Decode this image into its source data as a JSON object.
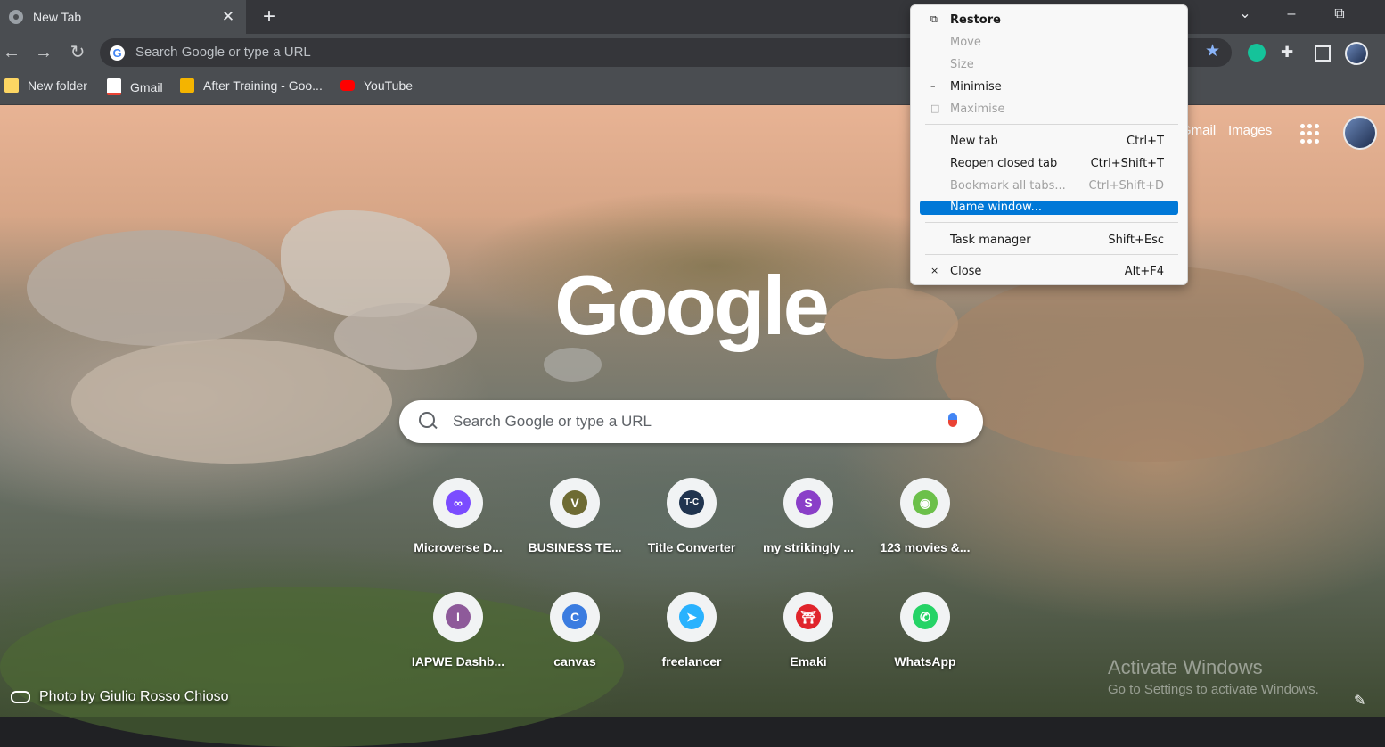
{
  "tab": {
    "title": "New Tab"
  },
  "window_controls": {
    "dropdown": "⌄",
    "minimize": "–",
    "restore": "⧉"
  },
  "omnibox": {
    "placeholder": "Search Google or type a URL"
  },
  "bookmarks": [
    {
      "label": "New folder",
      "icon": "folder-icon",
      "color": "#fdd663"
    },
    {
      "label": "Gmail",
      "icon": "gmail-icon",
      "color": "#ea4335"
    },
    {
      "label": "After Training - Goo...",
      "icon": "slides-icon",
      "color": "#f4b400"
    },
    {
      "label": "YouTube",
      "icon": "youtube-icon",
      "color": "#ff0000"
    }
  ],
  "ntp": {
    "top_links": {
      "gmail": "Gmail",
      "images": "Images"
    },
    "logo": "Google",
    "search_placeholder": "Search Google or type a URL",
    "shortcuts": [
      {
        "label": "Microverse D...",
        "icon_text": "∞",
        "color": "#7b4cff"
      },
      {
        "label": "BUSINESS TE...",
        "icon_text": "V",
        "color": "#6e6b33"
      },
      {
        "label": "Title Converter",
        "icon_text": "T-C",
        "color": "#20344f"
      },
      {
        "label": "my strikingly ...",
        "icon_text": "S",
        "color": "#8a3fc8"
      },
      {
        "label": "123 movies &...",
        "icon_text": "◉",
        "color": "#6cc04a"
      },
      {
        "label": "IAPWE Dashb...",
        "icon_text": "I",
        "color": "#8e5a9a"
      },
      {
        "label": "canvas",
        "icon_text": "C",
        "color": "#3b7ce0"
      },
      {
        "label": "freelancer",
        "icon_text": "➤",
        "color": "#29b2fe"
      },
      {
        "label": "Emaki",
        "icon_text": "⛩",
        "color": "#e0242b"
      },
      {
        "label": "WhatsApp",
        "icon_text": "✆",
        "color": "#25d366"
      }
    ],
    "photo_credit": "Photo by Giulio Rosso Chioso"
  },
  "activate": {
    "line1": "Activate Windows",
    "line2": "Go to Settings to activate Windows."
  },
  "system_menu": {
    "items": [
      {
        "label": "Restore",
        "icon": "⧉",
        "shortcut": "",
        "state": "bold"
      },
      {
        "label": "Move",
        "icon": "",
        "shortcut": "",
        "state": "disabled"
      },
      {
        "label": "Size",
        "icon": "",
        "shortcut": "",
        "state": "disabled"
      },
      {
        "label": "Minimise",
        "icon": "–",
        "shortcut": "",
        "state": "normal"
      },
      {
        "label": "Maximise",
        "icon": "□",
        "shortcut": "",
        "state": "disabled"
      },
      {
        "label": "New tab",
        "icon": "",
        "shortcut": "Ctrl+T",
        "state": "normal"
      },
      {
        "label": "Reopen closed tab",
        "icon": "",
        "shortcut": "Ctrl+Shift+T",
        "state": "normal"
      },
      {
        "label": "Bookmark all tabs...",
        "icon": "",
        "shortcut": "Ctrl+Shift+D",
        "state": "disabled"
      },
      {
        "label": "Name window...",
        "icon": "",
        "shortcut": "",
        "state": "highlighted"
      },
      {
        "label": "Task manager",
        "icon": "",
        "shortcut": "Shift+Esc",
        "state": "normal"
      },
      {
        "label": "Close",
        "icon": "×",
        "shortcut": "Alt+F4",
        "state": "normal"
      }
    ]
  }
}
